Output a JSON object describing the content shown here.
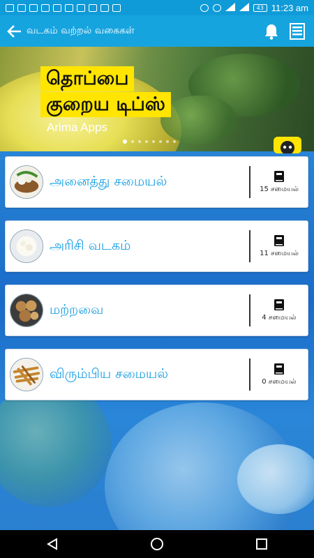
{
  "status_bar": {
    "time": "11:23 am",
    "battery": "43"
  },
  "app_bar": {
    "title": "வடகம் வற்றல் வகைகள்"
  },
  "banner": {
    "title_line1": "தொப்பை",
    "title_line2": "குறைய டிப்ஸ்",
    "subtitle": "Arima Apps",
    "page_count": 8,
    "active_page": 1
  },
  "categories": [
    {
      "label": "அனைத்து சமையல்",
      "count": "15 சமையல்",
      "thumb": "mixed-veg"
    },
    {
      "label": "அரிசி வடகம்",
      "count": "11 சமையல்",
      "thumb": "rice"
    },
    {
      "label": "மற்றவை",
      "count": "4 சமையல்",
      "thumb": "balls"
    },
    {
      "label": "விரும்பிய சமையல்",
      "count": "0 சமையல்",
      "thumb": "fries"
    }
  ],
  "colors": {
    "app_bar": "#16a4df",
    "status_bar": "#0f9bd8",
    "accent_text": "#1aa0e4",
    "banner_highlight": "#ffe500"
  }
}
